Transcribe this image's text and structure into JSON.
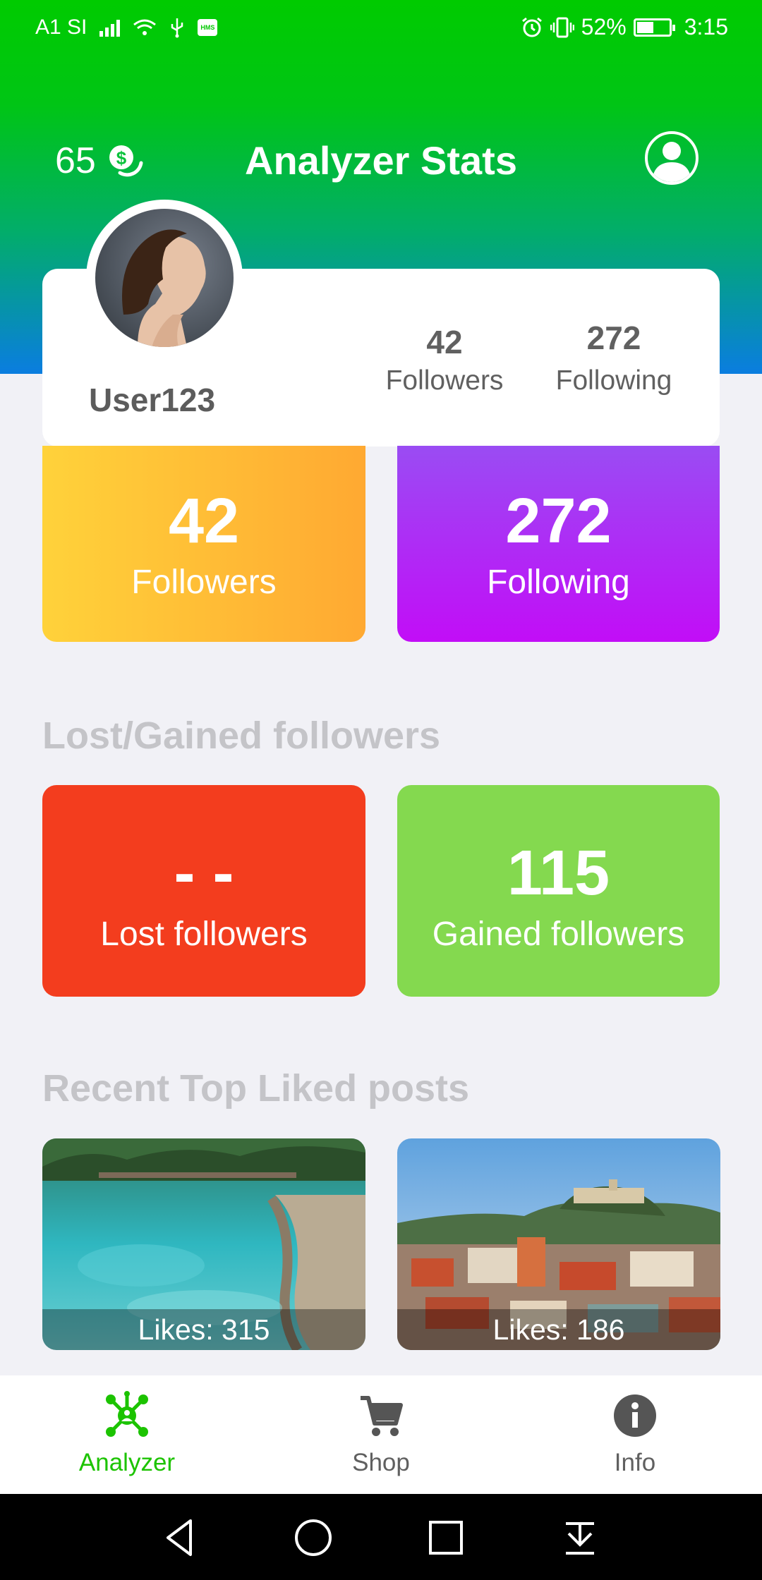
{
  "status_bar": {
    "carrier": "A1 SI",
    "battery": "52%",
    "battery_level": 0.52,
    "time": "3:15",
    "hms_badge": "HMS"
  },
  "header": {
    "coins": "65",
    "coin_icon": "dollar-coin-icon",
    "title": "Analyzer Stats",
    "profile_icon": "account-circle-icon"
  },
  "profile": {
    "username": "User123",
    "followers_count": "42",
    "followers_label": "Followers",
    "following_count": "272",
    "following_label": "Following"
  },
  "tiles": {
    "followers": {
      "value": "42",
      "label": "Followers",
      "colors": [
        "#ffd23a",
        "#ffa932"
      ]
    },
    "following": {
      "value": "272",
      "label": "Following",
      "colors": [
        "#9a4cf3",
        "#c20df7"
      ]
    }
  },
  "lost_gained": {
    "title": "Lost/Gained followers",
    "lost": {
      "value": "- -",
      "label": "Lost followers",
      "color": "#f33d1e"
    },
    "gained": {
      "value": "115",
      "label": "Gained followers",
      "color": "#84d94f"
    }
  },
  "recent_posts": {
    "title": "Recent Top Liked posts",
    "items": [
      {
        "likes": "Likes: 315"
      },
      {
        "likes": "Likes: 186"
      }
    ]
  },
  "bottom_nav": {
    "items": [
      {
        "label": "Analyzer",
        "icon": "analyzer-network-icon",
        "active": true
      },
      {
        "label": "Shop",
        "icon": "shopping-cart-icon",
        "active": false
      },
      {
        "label": "Info",
        "icon": "info-icon",
        "active": false
      }
    ],
    "accent": "#1cc300"
  }
}
